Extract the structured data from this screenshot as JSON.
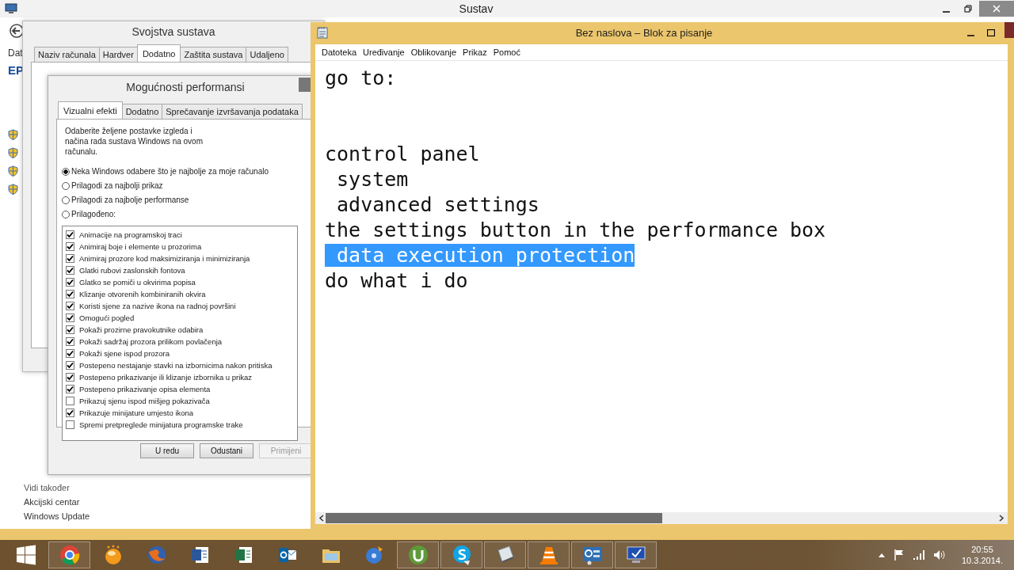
{
  "system_window": {
    "title": "Sustav",
    "sidebar_texts": [
      {
        "text": "Dat",
        "bold": false
      },
      {
        "text": "EP",
        "bold": true
      }
    ],
    "see_also_links": [
      "Vidi također",
      "Akcijski centar",
      "Windows Update"
    ]
  },
  "system_properties": {
    "title": "Svojstva sustava",
    "tabs": [
      {
        "label": "Naziv računala",
        "selected": false
      },
      {
        "label": "Hardver",
        "selected": false
      },
      {
        "label": "Dodatno",
        "selected": true
      },
      {
        "label": "Zaštita sustava",
        "selected": false
      },
      {
        "label": "Udaljeno",
        "selected": false
      }
    ]
  },
  "performance_options": {
    "title": "Mogućnosti performansi",
    "tabs": [
      {
        "label": "Vizualni efekti",
        "selected": true
      },
      {
        "label": "Dodatno",
        "selected": false
      },
      {
        "label": "Sprečavanje izvršavanja podataka",
        "selected": false
      }
    ],
    "description": "Odaberite željene postavke izgleda i načina rada sustava Windows na ovom računalu.",
    "radios": [
      {
        "label": "Neka Windows odabere što je najbolje za moje računalo",
        "selected": true
      },
      {
        "label": "Prilagodi za najbolji prikaz",
        "selected": false
      },
      {
        "label": "Prilagodi za najbolje performanse",
        "selected": false
      },
      {
        "label": "Prilagođeno:",
        "selected": false
      }
    ],
    "effects": [
      {
        "label": "Animacije na programskoj traci",
        "checked": true
      },
      {
        "label": "Animiraj boje i elemente u prozorima",
        "checked": true
      },
      {
        "label": "Animiraj prozore kod maksimiziranja i minimiziranja",
        "checked": true
      },
      {
        "label": "Glatki rubovi zaslonskih fontova",
        "checked": true
      },
      {
        "label": "Glatko se pomiči u okvirima popisa",
        "checked": true
      },
      {
        "label": "Klizanje otvorenih kombiniranih okvira",
        "checked": true
      },
      {
        "label": "Koristi sjene za nazive ikona na radnoj površini",
        "checked": true
      },
      {
        "label": "Omogući pogled",
        "checked": true
      },
      {
        "label": "Pokaži prozirne pravokutnike odabira",
        "checked": true
      },
      {
        "label": "Pokaži sadržaj prozora prilikom povlačenja",
        "checked": true
      },
      {
        "label": "Pokaži sjene ispod prozora",
        "checked": true
      },
      {
        "label": "Postepeno nestajanje stavki na izbornicima nakon pritiska",
        "checked": true
      },
      {
        "label": "Postepeno prikazivanje ili klizanje izbornika u prikaz",
        "checked": true
      },
      {
        "label": "Postepeno prikazivanje opisa elementa",
        "checked": true
      },
      {
        "label": "Prikazuj sjenu ispod mišjeg pokazivača",
        "checked": false
      },
      {
        "label": "Prikazuje minijature umjesto ikona",
        "checked": true
      },
      {
        "label": "Spremi pretpreglede minijatura programske trake",
        "checked": false
      }
    ],
    "buttons": [
      {
        "label": "U redu",
        "disabled": false
      },
      {
        "label": "Odustani",
        "disabled": false
      },
      {
        "label": "Primijeni",
        "disabled": true
      }
    ]
  },
  "notepad": {
    "title": "Bez naslova – Blok za pisanje",
    "menu": [
      "Datoteka",
      "Uređivanje",
      "Oblikovanje",
      "Prikaz",
      "Pomoć"
    ],
    "paragraphs": [
      {
        "lines": [
          {
            "text": "go to:",
            "selected": false
          }
        ]
      },
      {
        "lines": [
          {
            "text": "control panel",
            "selected": false
          },
          {
            "text": " system",
            "selected": false
          },
          {
            "text": " advanced settings",
            "selected": false
          },
          {
            "text": "the settings button in the performance box",
            "selected": false
          },
          {
            "text": " data execution protection",
            "selected": true
          },
          {
            "text": "do what i do",
            "selected": false
          }
        ]
      }
    ]
  },
  "taskbar": {
    "items": [
      {
        "kind": "windows",
        "open": false
      },
      {
        "kind": "globe",
        "open": true
      },
      {
        "kind": "orb",
        "open": false
      },
      {
        "kind": "fox",
        "open": false
      },
      {
        "kind": "doc",
        "open": false
      },
      {
        "kind": "sheet",
        "open": false
      },
      {
        "kind": "mail",
        "open": false
      },
      {
        "kind": "folder",
        "open": false
      },
      {
        "kind": "disc",
        "open": false
      },
      {
        "kind": "torrent",
        "open": true
      },
      {
        "kind": "chat",
        "open": true
      },
      {
        "kind": "notepad",
        "open": true
      },
      {
        "kind": "cone",
        "open": true
      },
      {
        "kind": "panel",
        "open": true
      },
      {
        "kind": "monitor",
        "open": true
      }
    ],
    "time": "20:55",
    "date": "10.3.2014."
  }
}
